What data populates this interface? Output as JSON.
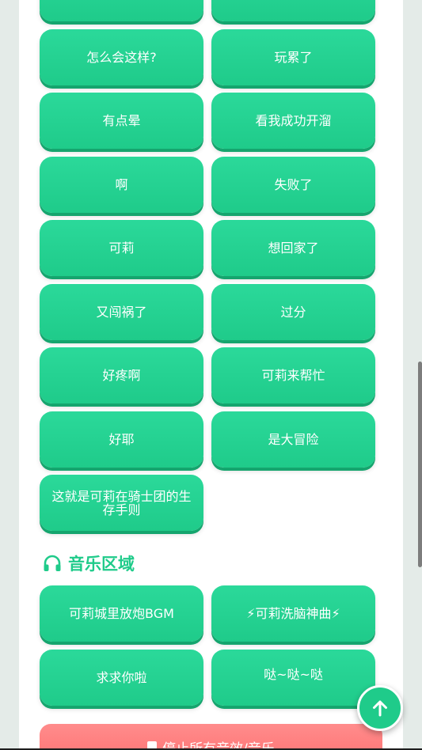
{
  "sound_buttons": [
    {
      "label": ""
    },
    {
      "label": ""
    },
    {
      "label": "怎么会这样?"
    },
    {
      "label": "玩累了"
    },
    {
      "label": "有点晕"
    },
    {
      "label": "看我成功开溜"
    },
    {
      "label": "啊"
    },
    {
      "label": "失败了"
    },
    {
      "label": "可莉"
    },
    {
      "label": "想回家了"
    },
    {
      "label": "又闯祸了"
    },
    {
      "label": "过分"
    },
    {
      "label": "好疼啊"
    },
    {
      "label": "可莉来帮忙"
    },
    {
      "label": "好耶"
    },
    {
      "label": "是大冒险"
    },
    {
      "label": "这就是可莉在骑士团的生存手则"
    }
  ],
  "music_section": {
    "title": "音乐区域",
    "icon": "headphones-icon",
    "buttons": [
      {
        "label": "可莉城里放炮BGM"
      },
      {
        "label": "⚡可莉洗脑神曲⚡"
      },
      {
        "label": "求求你啦"
      },
      {
        "label": "哒~哒~哒"
      }
    ]
  },
  "stop_button": {
    "label": "停止所有音效/音乐"
  },
  "scroll_top_button": {
    "icon": "arrow-up-icon"
  },
  "colors": {
    "accent": "#1fcb8a",
    "accent_shadow": "#15a56e",
    "danger": "#ff6e6e",
    "background": "#e4ebe8"
  }
}
